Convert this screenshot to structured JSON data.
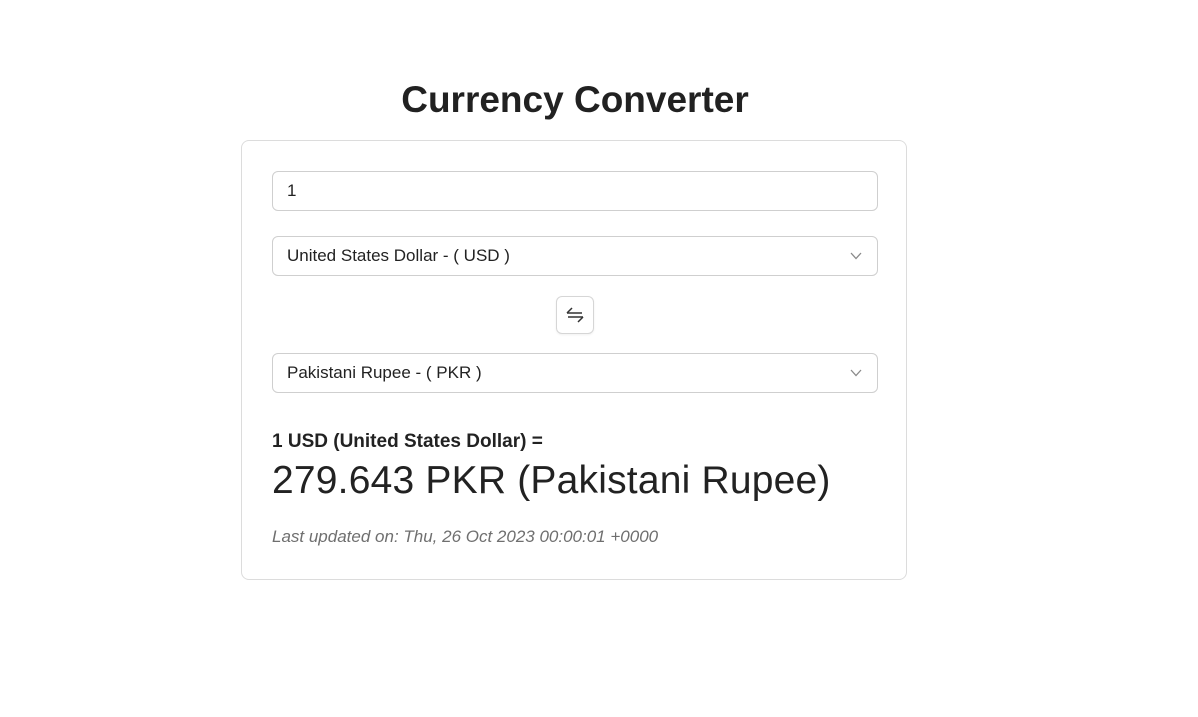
{
  "app": {
    "title": "Currency Converter"
  },
  "converter": {
    "amount": "1",
    "from_currency": "United States Dollar - ( USD )",
    "to_currency": "Pakistani Rupee - ( PKR )",
    "swap_icon": "swap-arrows-icon",
    "dropdown_icon": "chevron-down-icon"
  },
  "result": {
    "from_text": "1 USD (United States Dollar) =",
    "to_text": "279.643 PKR (Pakistani Rupee)",
    "last_updated": "Last updated on: Thu, 26 Oct 2023 00:00:01 +0000"
  },
  "colors": {
    "text": "#222222",
    "border": "#dcdcdc",
    "muted": "#6f6f6f",
    "background": "#ffffff"
  }
}
